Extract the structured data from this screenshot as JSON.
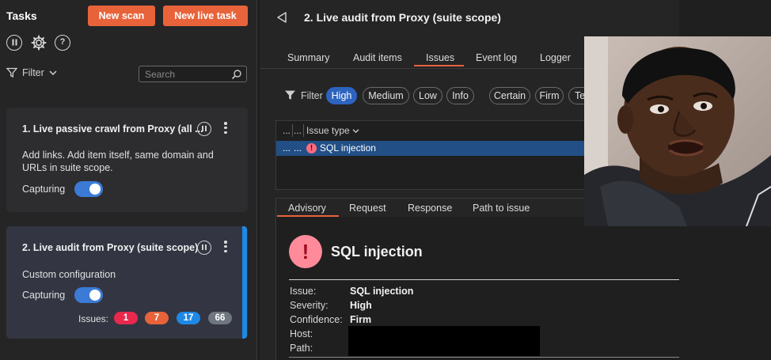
{
  "left_panel": {
    "title": "Tasks",
    "new_scan_label": "New scan",
    "new_live_task_label": "New live task",
    "filter_label": "Filter",
    "search_placeholder": "Search",
    "tasks": [
      {
        "title": "1. Live passive crawl from Proxy (all ...",
        "description": "Add links. Add item itself, same domain and URLs in suite scope.",
        "capturing_label": "Capturing"
      },
      {
        "title": "2. Live audit from Proxy (suite scope)",
        "description": "Custom configuration",
        "capturing_label": "Capturing",
        "issues_label": "Issues:",
        "issue_counts": [
          {
            "count": "1",
            "color": "#e8294d"
          },
          {
            "count": "7",
            "color": "#e8633a"
          },
          {
            "count": "17",
            "color": "#1e88e5"
          },
          {
            "count": "66",
            "color": "#6f7680"
          }
        ]
      }
    ]
  },
  "main": {
    "title": "2. Live audit from Proxy (suite scope)",
    "tabs": [
      "Summary",
      "Audit items",
      "Issues",
      "Event log",
      "Logger"
    ],
    "active_tab": "Issues",
    "filter_label": "Filter",
    "filter_chips": [
      "High",
      "Medium",
      "Low",
      "Info",
      "Certain",
      "Firm",
      "Te"
    ],
    "active_chip": "High",
    "table": {
      "col1": "...",
      "col2": "...",
      "col3": "Issue type",
      "rows": [
        {
          "c1": "...",
          "c2": "...",
          "issue": "SQL injection"
        }
      ]
    },
    "detail_tabs": [
      "Advisory",
      "Request",
      "Response",
      "Path to issue"
    ],
    "active_detail_tab": "Advisory",
    "advisory": {
      "title": "SQL injection",
      "fields": [
        {
          "key": "Issue:",
          "value": "SQL injection"
        },
        {
          "key": "Severity:",
          "value": "High"
        },
        {
          "key": "Confidence:",
          "value": "Firm"
        },
        {
          "key": "Host:",
          "value": ""
        },
        {
          "key": "Path:",
          "value": ""
        }
      ]
    }
  }
}
